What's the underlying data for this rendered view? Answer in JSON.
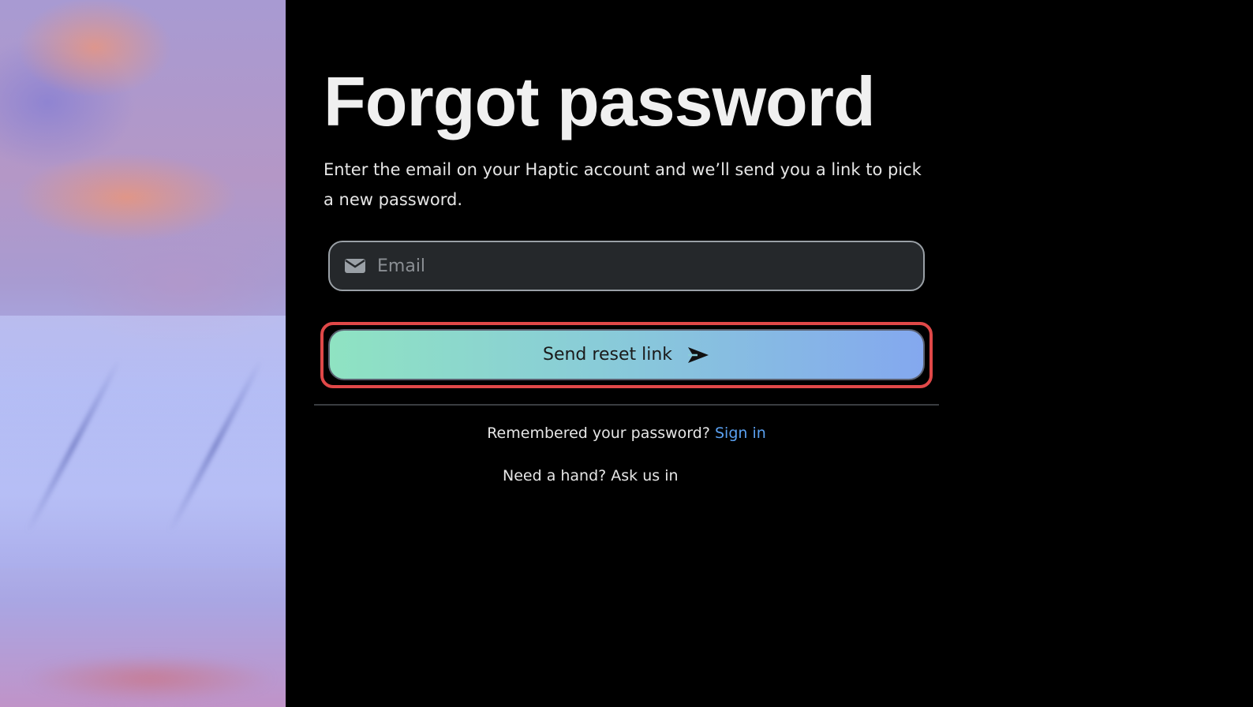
{
  "page": {
    "title": "Forgot password",
    "subtitle": "Enter the email on your Haptic account and we’ll send you a link to pick a new password."
  },
  "form": {
    "email_placeholder": "Email",
    "email_value": "",
    "email_icon": "envelope-icon",
    "submit_label": "Send reset link",
    "submit_icon": "send-arrow-icon"
  },
  "footer": {
    "remembered_text": "Remembered your password?",
    "signin_label": "Sign in",
    "help_text": "Need a hand? Ask us in"
  },
  "colors": {
    "background": "#000000",
    "link": "#5aa0f0",
    "button_gradient_start": "#8fe3c2",
    "button_gradient_end": "#84a8ef",
    "highlight_outline": "#e04848"
  }
}
